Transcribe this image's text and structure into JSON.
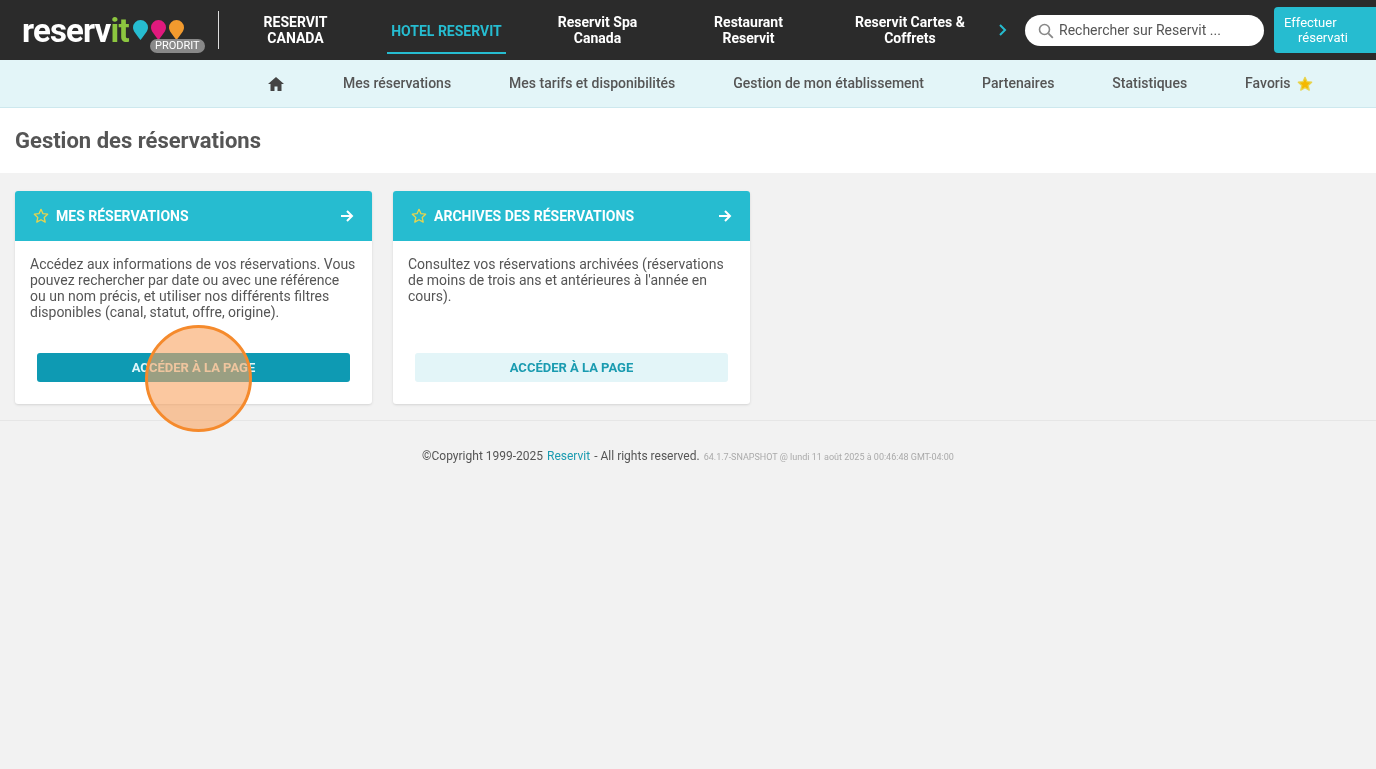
{
  "logo": {
    "text": "reserv",
    "accent": "it",
    "badge": "PRODRIT"
  },
  "top_nav": [
    {
      "label": "RESERVIT CANADA",
      "selected": false
    },
    {
      "label": "HOTEL RESERVIT",
      "selected": true
    },
    {
      "label": "Reservit Spa Canada",
      "selected": false
    },
    {
      "label": "Restaurant Reservit",
      "selected": false
    },
    {
      "label": "Reservit Cartes & Coffrets",
      "selected": false
    }
  ],
  "search": {
    "placeholder": "Rechercher sur Reservit ..."
  },
  "action_button": {
    "lines": [
      "Effectuer",
      "réservati"
    ]
  },
  "sub_nav": [
    {
      "label": "Mes réservations"
    },
    {
      "label": "Mes tarifs et disponibilités"
    },
    {
      "label": "Gestion de mon établissement"
    },
    {
      "label": "Partenaires"
    },
    {
      "label": "Statistiques"
    },
    {
      "label": "Favoris"
    }
  ],
  "page_title": "Gestion des réservations",
  "cards": [
    {
      "title": "MES RÉSERVATIONS",
      "description": "Accédez aux informations de vos réservations. Vous pouvez rechercher par date ou avec une référence ou un nom précis, et utiliser nos différents filtres disponibles (canal, statut, offre, origine).",
      "button": "ACCÉDER À LA PAGE",
      "highlighted": true,
      "clicked": true
    },
    {
      "title": "ARCHIVES DES RÉSERVATIONS",
      "description": "Consultez vos réservations archivées (réservations de moins de trois ans et antérieures à l'année en cours).",
      "button": "ACCÉDER À LA PAGE",
      "highlighted": false,
      "clicked": false
    }
  ],
  "footer": {
    "copyright": "©Copyright 1999-2025",
    "link": "Reservit",
    "rights": "- All rights reserved.",
    "version": "64.1.7-SNAPSHOT @ lundi 11 août 2025 à 00:46:48 GMT-04:00"
  }
}
